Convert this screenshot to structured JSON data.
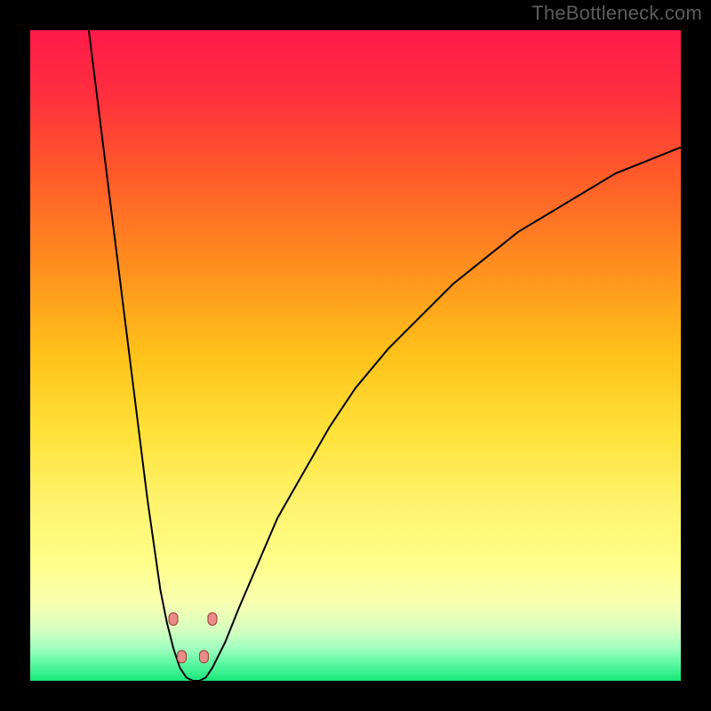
{
  "watermark": {
    "text": "TheBottleneck.com"
  },
  "colors": {
    "frame": "#000000",
    "gradient_stops": [
      {
        "offset": 0.0,
        "color": "#ff1a4b"
      },
      {
        "offset": 0.1,
        "color": "#ff2f3e"
      },
      {
        "offset": 0.22,
        "color": "#ff5a2a"
      },
      {
        "offset": 0.35,
        "color": "#ff8a1f"
      },
      {
        "offset": 0.5,
        "color": "#ffc21a"
      },
      {
        "offset": 0.62,
        "color": "#ffe23a"
      },
      {
        "offset": 0.72,
        "color": "#fff26a"
      },
      {
        "offset": 0.82,
        "color": "#ffff8a"
      },
      {
        "offset": 0.88,
        "color": "#f9ffb0"
      },
      {
        "offset": 0.92,
        "color": "#d8ffc0"
      },
      {
        "offset": 0.95,
        "color": "#a0ffbf"
      },
      {
        "offset": 0.975,
        "color": "#58f7a0"
      },
      {
        "offset": 1.0,
        "color": "#17e879"
      }
    ],
    "curve": "#000000",
    "marker_fill": "#e98b87",
    "marker_stroke": "#9d3c38"
  },
  "chart_data": {
    "type": "line",
    "title": "",
    "xlabel": "",
    "ylabel": "",
    "xlim": [
      0,
      100
    ],
    "ylim": [
      0,
      100
    ],
    "grid": false,
    "x": [
      9,
      10,
      11,
      12,
      13,
      14,
      15,
      16,
      17,
      18,
      19,
      20,
      21,
      22,
      23,
      24,
      25,
      26,
      27,
      28,
      30,
      32,
      35,
      38,
      42,
      46,
      50,
      55,
      60,
      65,
      70,
      75,
      80,
      85,
      90,
      95,
      100
    ],
    "y": [
      100,
      92,
      84,
      76,
      68,
      60,
      52,
      44,
      36,
      28,
      21,
      14,
      9,
      5,
      2,
      0.5,
      0,
      0,
      0.5,
      2,
      6,
      11,
      18,
      25,
      32,
      39,
      45,
      51,
      56,
      61,
      65,
      69,
      72,
      75,
      78,
      80,
      82
    ],
    "markers": {
      "x": [
        22.0,
        23.3,
        26.7,
        28.0
      ],
      "y": [
        9.5,
        3.7,
        3.7,
        9.5
      ]
    },
    "annotations": []
  }
}
